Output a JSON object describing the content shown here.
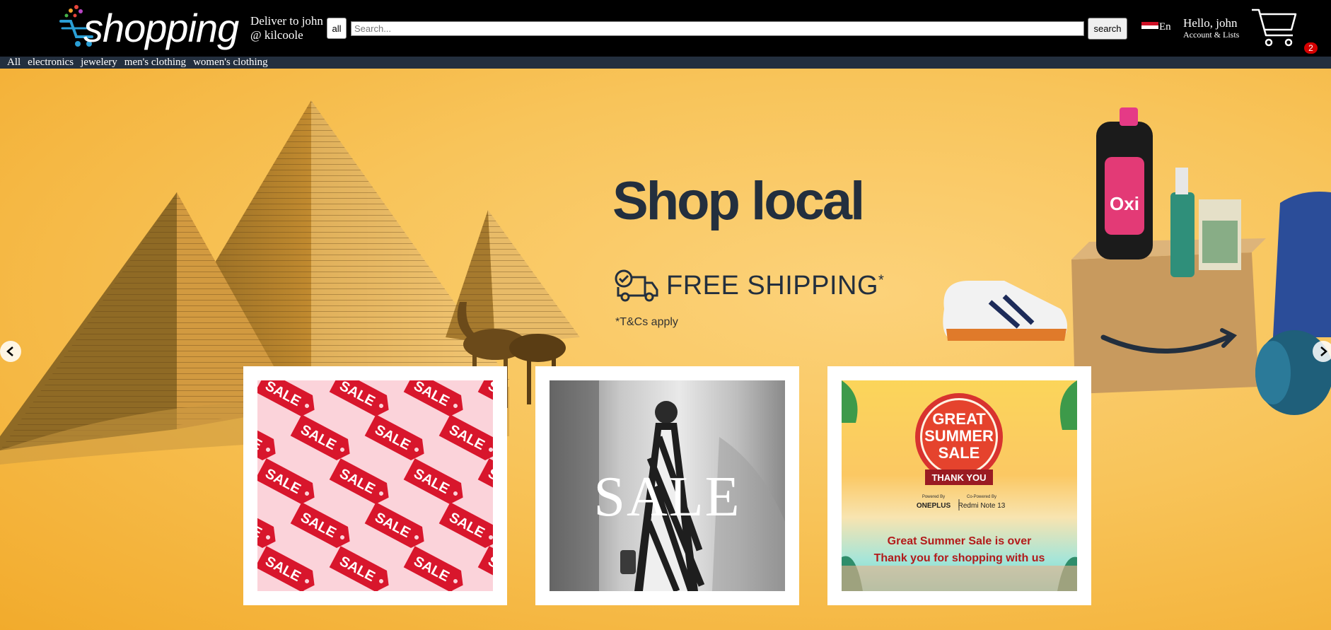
{
  "header": {
    "logo_text": "shopping",
    "deliver_line1": "Deliver to john",
    "deliver_line2": "@ kilcoole",
    "category_select": "all",
    "search_placeholder": "Search...",
    "search_button": "search",
    "language": "En",
    "greeting": "Hello, john",
    "account_lists": "Account & Lists",
    "cart_count": "2",
    "flag_colors": [
      "#ce1126",
      "#ffffff",
      "#000000"
    ]
  },
  "nav": {
    "items": [
      "All",
      "electronics",
      "jewelery",
      "men's clothing",
      "women's clothing"
    ]
  },
  "hero": {
    "headline": "Shop local",
    "shipping": "FREE SHIPPING",
    "shipping_mark": "*",
    "terms": "*T&Cs apply",
    "left_arrow_icon": "chevron-left-icon",
    "right_arrow_icon": "chevron-right-icon"
  },
  "cards": {
    "sale_tag": "SALE",
    "fashion_sale": "SALE",
    "summer": {
      "line1": "GREAT",
      "line2": "SUMMER",
      "line3": "SALE",
      "ribbon": "THANK YOU",
      "powered_by": "Powered By",
      "powered_brand": "ONEPLUS",
      "co_powered": "Co-Powered By",
      "co_brand": "Redmi Note 13",
      "over_line1": "Great Summer Sale is over",
      "over_line2": "Thank you for shopping with us"
    }
  },
  "colors": {
    "header_bg": "#000000",
    "nav_bg": "#232f3e",
    "hero_bg": "#f8c45a",
    "headline": "#232f3e",
    "badge": "#d40000"
  }
}
